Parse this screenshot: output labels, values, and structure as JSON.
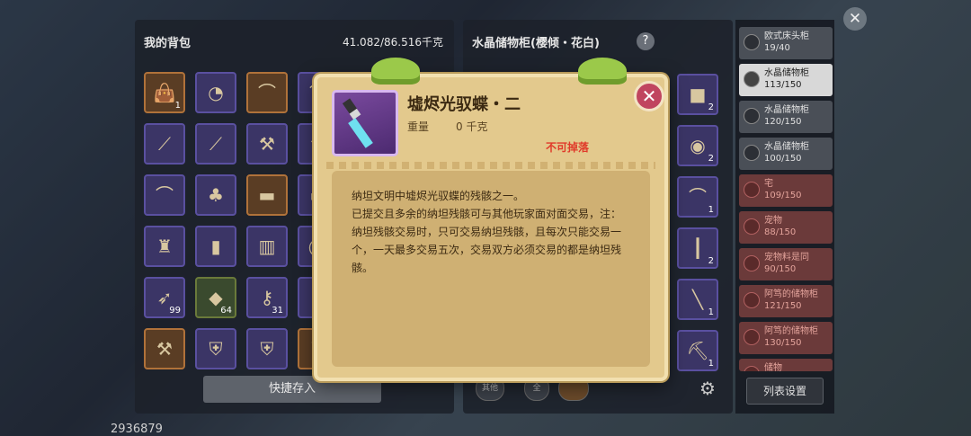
{
  "backpack": {
    "title": "我的背包",
    "weight": "41.082/86.516千克",
    "quick_store_label": "快捷存入",
    "slots": [
      {
        "icon": "bag-icon",
        "count": "1",
        "variant": "orange"
      },
      {
        "icon": "mask-icon",
        "count": "",
        "variant": "purple"
      },
      {
        "icon": "bow-icon",
        "count": "",
        "variant": "orange"
      },
      {
        "icon": "bow-icon",
        "count": "",
        "variant": "purple"
      },
      {
        "icon": "spear-icon",
        "count": "",
        "variant": "purple"
      },
      {
        "icon": "spear-icon",
        "count": "",
        "variant": "purple"
      },
      {
        "icon": "axe-icon",
        "count": "",
        "variant": "purple"
      },
      {
        "icon": "axe-icon",
        "count": "",
        "variant": "purple"
      },
      {
        "icon": "bow-icon",
        "count": "",
        "variant": "purple"
      },
      {
        "icon": "teapot-icon",
        "count": "",
        "variant": "purple"
      },
      {
        "icon": "gun-icon",
        "count": "",
        "variant": "orange"
      },
      {
        "icon": "gun-icon",
        "count": "",
        "variant": "purple"
      },
      {
        "icon": "armor-icon",
        "count": "",
        "variant": "purple"
      },
      {
        "icon": "boots-icon",
        "count": "",
        "variant": "purple"
      },
      {
        "icon": "pants-icon",
        "count": "",
        "variant": "purple"
      },
      {
        "icon": "ring-icon",
        "count": "",
        "variant": "purple"
      },
      {
        "icon": "feather-icon",
        "count": "99",
        "variant": "purple"
      },
      {
        "icon": "crystal-icon",
        "count": "64",
        "variant": "green"
      },
      {
        "icon": "key-icon",
        "count": "31",
        "variant": "purple"
      },
      {
        "icon": "key-icon",
        "count": "",
        "variant": "purple"
      },
      {
        "icon": "hammer-icon",
        "count": "",
        "variant": "orange"
      },
      {
        "icon": "shield-icon",
        "count": "",
        "variant": "purple"
      },
      {
        "icon": "shield-icon",
        "count": "",
        "variant": "purple"
      },
      {
        "icon": "shield-icon",
        "count": "",
        "variant": "orange"
      }
    ]
  },
  "storage": {
    "title": "水晶储物柜(樱倾・花白)",
    "help_icon": "question-icon",
    "column": [
      {
        "icon": "anvil-icon",
        "count": "2"
      },
      {
        "icon": "disk-icon",
        "count": "2"
      },
      {
        "icon": "bow-icon",
        "count": "1"
      },
      {
        "icon": "torch-icon",
        "count": "2"
      },
      {
        "icon": "staff-icon",
        "count": "1"
      },
      {
        "icon": "pick-icon",
        "count": "1"
      }
    ],
    "mini_buttons": [
      "其他",
      "全",
      ""
    ]
  },
  "sidebar": {
    "list_settings_label": "列表设置",
    "items": [
      {
        "name": "欧式床头柜",
        "capacity": "19/40",
        "state": "normal"
      },
      {
        "name": "水晶储物柜",
        "capacity": "113/150",
        "state": "active"
      },
      {
        "name": "水晶储物柜",
        "capacity": "120/150",
        "state": "normal"
      },
      {
        "name": "水晶储物柜",
        "capacity": "100/150",
        "state": "normal"
      },
      {
        "name": "宅",
        "capacity": "109/150",
        "state": "red"
      },
      {
        "name": "宠物",
        "capacity": "88/150",
        "state": "red"
      },
      {
        "name": "宠物料是同",
        "capacity": "90/150",
        "state": "red"
      },
      {
        "name": "阿笃的储物柜",
        "capacity": "121/150",
        "state": "red"
      },
      {
        "name": "阿笃的储物柜",
        "capacity": "130/150",
        "state": "red"
      },
      {
        "name": "储物",
        "capacity": "",
        "state": "red"
      }
    ]
  },
  "player_id": "2936879",
  "popup": {
    "item_name": "墟烬光驭蝶・二",
    "weight_label": "重量",
    "weight_value": "0 千克",
    "no_drop": "不可掉落",
    "close_icon": "close-icon",
    "description": [
      "纳坦文明中墟烬光驭蝶的残骸之一。",
      "已提交且多余的纳坦残骸可与其他玩家面对面交易，注：纳坦残骸交易时，只可交易纳坦残骸，且每次只能交易一个，一天最多交易五次，交易双方必须交易的都是纳坦残骸。"
    ]
  }
}
